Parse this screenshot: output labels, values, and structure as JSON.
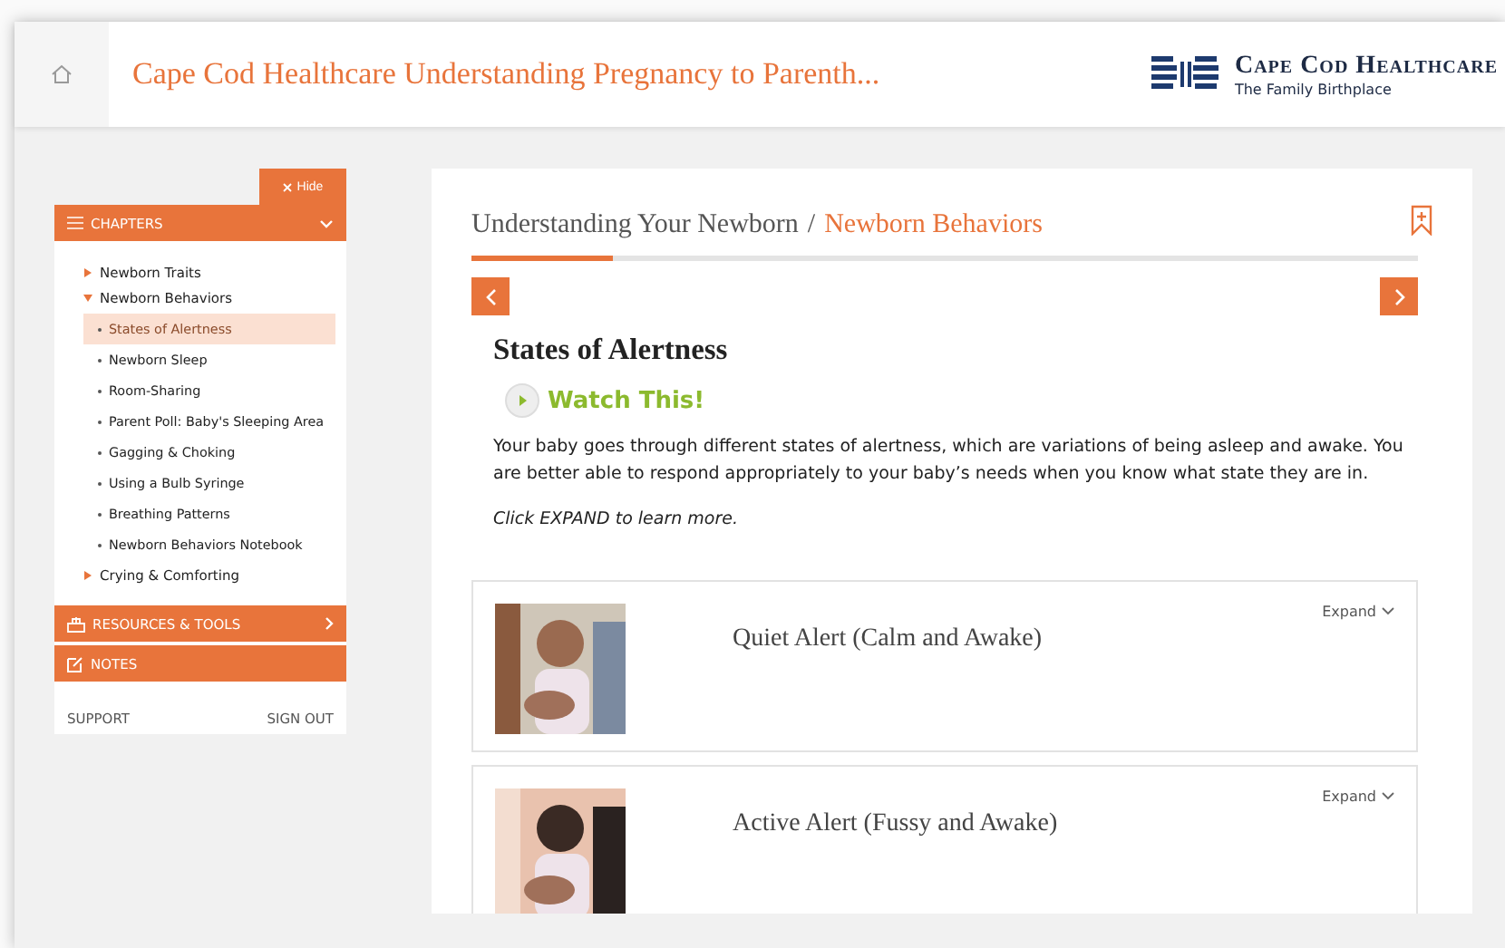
{
  "header": {
    "title": "Cape Cod Healthcare Understanding Pregnancy to Parenth...",
    "logo_name": "Cape Cod Healthcare",
    "logo_tagline": "The Family Birthplace"
  },
  "sidebar": {
    "hide_label": "Hide",
    "chapters_label": "CHAPTERS",
    "chapters": [
      {
        "label": "Newborn Traits",
        "expanded": false
      },
      {
        "label": "Newborn Behaviors",
        "expanded": true,
        "children": [
          {
            "label": "States of Alertness",
            "selected": true
          },
          {
            "label": "Newborn Sleep",
            "selected": false
          },
          {
            "label": "Room-Sharing",
            "selected": false
          },
          {
            "label": "Parent Poll: Baby's Sleeping Area",
            "selected": false
          },
          {
            "label": "Gagging & Choking",
            "selected": false
          },
          {
            "label": "Using a Bulb Syringe",
            "selected": false
          },
          {
            "label": "Breathing Patterns",
            "selected": false
          },
          {
            "label": "Newborn Behaviors Notebook",
            "selected": false
          }
        ]
      },
      {
        "label": "Crying & Comforting",
        "expanded": false
      }
    ],
    "resources_label": "RESOURCES & TOOLS",
    "notes_label": "NOTES",
    "support_label": "SUPPORT",
    "signout_label": "SIGN OUT"
  },
  "content": {
    "breadcrumb_parent": "Understanding Your Newborn",
    "breadcrumb_separator": "/",
    "breadcrumb_current": "Newborn Behaviors",
    "progress": {
      "level": 0.15
    },
    "heading": "States of Alertness",
    "watch_label": "Watch This!",
    "paragraph": "Your baby goes through different states of alertness, which are variations of being asleep and awake. You are better able to respond appropriately to your baby’s needs when you know what state they are in.",
    "hint": "Click EXPAND to learn more.",
    "sections": [
      {
        "title": "Quiet Alert (Calm and Awake)",
        "expand_label": "Expand"
      },
      {
        "title": "Active Alert (Fussy and Awake)",
        "expand_label": "Expand"
      }
    ]
  }
}
